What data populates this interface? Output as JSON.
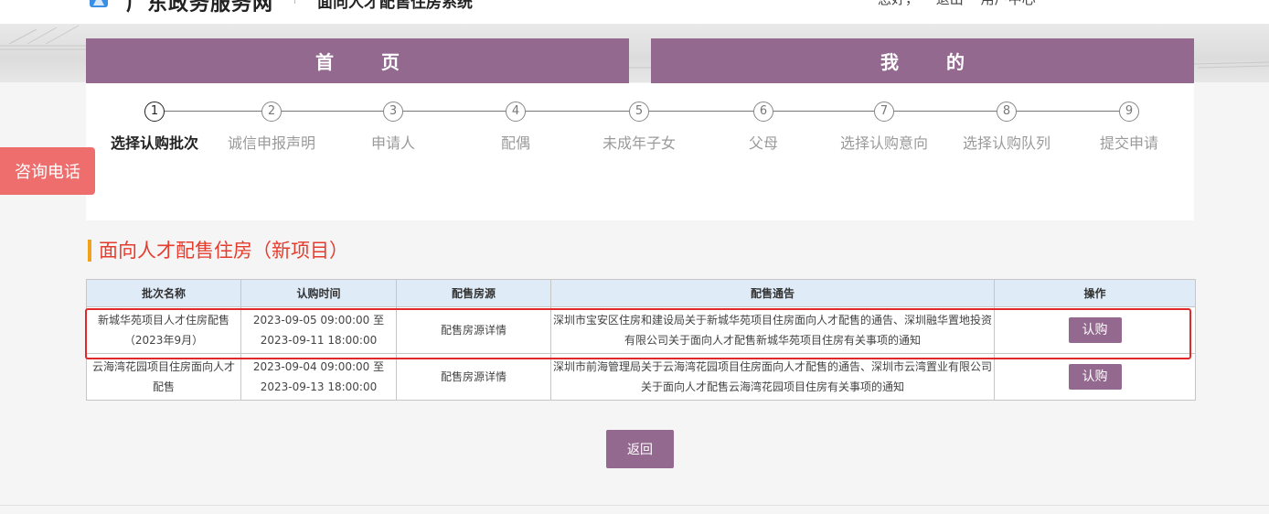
{
  "header": {
    "site_title": "广东政务服务网",
    "system_name": "面向人才配售住房系统",
    "top_links": [
      "您好，",
      "退出",
      "用户中心"
    ]
  },
  "nav": {
    "home": [
      "首",
      "页"
    ],
    "mine": [
      "我",
      "的"
    ]
  },
  "consult_label": "咨询电话",
  "steps": [
    {
      "num": "1",
      "label": "选择认购批次",
      "active": true
    },
    {
      "num": "2",
      "label": "诚信申报声明",
      "active": false
    },
    {
      "num": "3",
      "label": "申请人",
      "active": false
    },
    {
      "num": "4",
      "label": "配偶",
      "active": false
    },
    {
      "num": "5",
      "label": "未成年子女",
      "active": false
    },
    {
      "num": "6",
      "label": "父母",
      "active": false
    },
    {
      "num": "7",
      "label": "选择认购意向",
      "active": false
    },
    {
      "num": "8",
      "label": "选择认购队列",
      "active": false
    },
    {
      "num": "9",
      "label": "提交申请",
      "active": false
    }
  ],
  "section_title": "面向人才配售住房（新项目）",
  "table": {
    "headers": [
      "批次名称",
      "认购时间",
      "配售房源",
      "配售通告",
      "操作"
    ],
    "rows": [
      {
        "name": "新城华苑项目人才住房配售（2023年9月）",
        "time": "2023-09-05 09:00:00 至 2023-09-11 18:00:00",
        "source": "配售房源详情",
        "notice": "深圳市宝安区住房和建设局关于新城华苑项目住房面向人才配售的通告、深圳融华置地投资有限公司关于面向人才配售新城华苑项目住房有关事项的通知",
        "action": "认购"
      },
      {
        "name": "云海湾花园项目住房面向人才配售",
        "time": "2023-09-04 09:00:00 至 2023-09-13 18:00:00",
        "source": "配售房源详情",
        "notice": "深圳市前海管理局关于云海湾花园项目住房面向人才配售的通告、深圳市云湾置业有限公司关于面向人才配售云海湾花园项目住房有关事项的通知",
        "action": "认购"
      }
    ]
  },
  "back_label": "返回",
  "colors": {
    "brand_purple": "#94698f",
    "title_red": "#e63c2e",
    "accent_orange": "#f2a21a",
    "consult_red": "#ee6e6e",
    "header_blue": "#dfebf7",
    "link_blue": "#2433a8"
  }
}
